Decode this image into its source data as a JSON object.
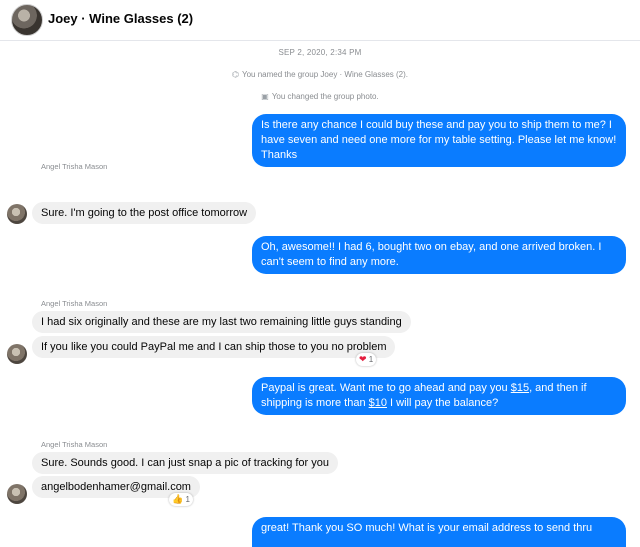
{
  "header": {
    "title": "Joey · Wine Glasses (2)"
  },
  "timestamp": "SEP 2, 2020, 2:34 PM",
  "events": [
    {
      "icon": "tag-icon",
      "text": "You named the group Joey · Wine Glasses (2)."
    },
    {
      "icon": "photo-icon",
      "text": "You changed the group photo."
    }
  ],
  "messages": {
    "m1": "Is there any chance I could buy these and pay you to ship them to me?  I have seven and need one more for my table setting.  Please let me know! Thanks",
    "s1": "Angel Trisha Mason",
    "m2": "Sure. I'm going to the post office tomorrow",
    "m3": "Oh, awesome!!  I had 6, bought two on ebay, and one arrived broken.  I can't seem to find any more.",
    "s2": "Angel Trisha Mason",
    "m4": "I had six originally and these are my last two remaining little guys standing",
    "m5": "If you like you could PayPal me and I can ship those to you no problem",
    "m5_reaction": {
      "icon": "heart-icon",
      "count": "1"
    },
    "m6_a": "Paypal is great.  Want me to go ahead and pay you ",
    "m6_amt1": "$15",
    "m6_b": ", and then if shipping is more than ",
    "m6_amt2": "$10",
    "m6_c": " I will pay the balance?",
    "s3": "Angel Trisha Mason",
    "m7": "Sure. Sounds good. I can just snap a pic of tracking for you",
    "m8": "angelbodenhamer@gmail.com",
    "m8_reaction": {
      "icon": "thumbs-up-icon",
      "count": "1"
    },
    "m9": "great!  Thank you SO much!  What is your email address to send thru"
  }
}
